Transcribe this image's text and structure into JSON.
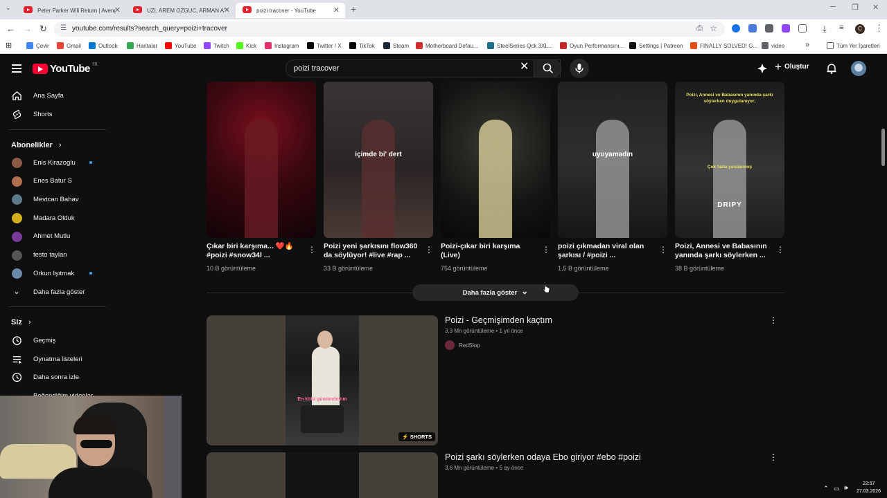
{
  "browser": {
    "tabs": [
      {
        "title": "Peter Parker Will Return | Aveng",
        "active": false
      },
      {
        "title": "UZI, AREM OZGUC, ARMAN AY",
        "active": false
      },
      {
        "title": "poizi tracover - YouTube",
        "active": true
      }
    ],
    "url": "youtube.com/results?search_query=poizi+tracover",
    "bookmarks": [
      "Çevir",
      "Gmail",
      "Outlook",
      "Haritalar",
      "YouTube",
      "Twitch",
      "Kick",
      "Instagram",
      "Twitter / X",
      "TikTok",
      "Steam",
      "Motherboard Defau...",
      "SteelSeries Qck 3XL...",
      "Oyun Performansını...",
      "Settings | Patreon",
      "FINALLY SOLVED! G...",
      "video"
    ],
    "bookmarks_all": "Tüm Yer İşaretleri",
    "bookmark_colors": [
      "#4285f4",
      "#ea4335",
      "#0078d4",
      "#34a853",
      "#ff0000",
      "#9146ff",
      "#53fc18",
      "#e1306c",
      "#000000",
      "#010101",
      "#1b2838",
      "#d32f2f",
      "#1f6f8b",
      "#c62828",
      "#111111",
      "#e64a19",
      "#5f6368"
    ],
    "profile_initial": "C"
  },
  "youtube": {
    "logo": "YouTube",
    "logo_region": "TR",
    "search_query": "poizi tracover",
    "create_label": "Oluştur",
    "accent": "#ff0033",
    "sidebar": {
      "home": "Ana Sayfa",
      "shorts": "Shorts",
      "subscriptions_title": "Abonelikler",
      "channels": [
        {
          "name": "Enis Kirazoglu",
          "new": true,
          "color": "#8a5a44"
        },
        {
          "name": "Enes Batur S",
          "new": false,
          "color": "#b07050"
        },
        {
          "name": "Mevtcan Bahav",
          "new": false,
          "color": "#5a7a8a"
        },
        {
          "name": "Madara Olduk",
          "new": false,
          "color": "#d4b020"
        },
        {
          "name": "Ahmet Mutlu",
          "new": false,
          "color": "#7a3a9a"
        },
        {
          "name": "testo taylan",
          "new": false,
          "color": "#555555"
        },
        {
          "name": "Orkun Işıtmak",
          "new": true,
          "color": "#6a8aaa"
        }
      ],
      "show_more": "Daha fazla göster",
      "you_title": "Siz",
      "history": "Geçmiş",
      "playlists": "Oynatma listeleri",
      "watch_later": "Daha sonra izle",
      "liked": "Beğendiğim videolar"
    },
    "shorts": [
      {
        "title": "Çıkar biri karşıma... ❤️🔥 #poizi #snow34l ...",
        "views": "10 B görüntüleme",
        "caption": ""
      },
      {
        "title": "Poizi yeni şarkısını flow360 da söylüyor! #live #rap ...",
        "views": "33 B görüntüleme",
        "caption": "içimde bi' dert"
      },
      {
        "title": "Poizi-çıkar biri karşıma (Live)",
        "views": "754 görüntüleme",
        "caption": ""
      },
      {
        "title": "poizi çıkmadan viral olan şarkısı / #poizi ...",
        "views": "1,5 B görüntüleme",
        "caption": "uyuyamadın"
      },
      {
        "title": "Poizi, Annesi ve Babasının yanında şarkı söylerken ...",
        "views": "38 B görüntüleme",
        "caption": "DRIPY"
      }
    ],
    "short5_top_caption": "Poizi, Annesi ve Babasının yanında şarkı söylerken duygulanıyor;",
    "short5_mid_caption": "Çok fazla yaralanmış",
    "show_more_label": "Daha fazla göster",
    "videos": [
      {
        "title": "Poizi - Geçmişimden kaçtım",
        "views": "3,3 Mn görüntüleme",
        "age": "1 yıl önce",
        "channel": "RedSlop",
        "badge": "SHORTS",
        "overlay": "En kötü günümdeyim"
      },
      {
        "title": "Poizi şarkı söylerken odaya Ebo giriyor #ebo #poizi",
        "views": "3,6 Mn görüntüleme",
        "age": "5 ay önce",
        "channel": "",
        "badge": "",
        "overlay": ""
      }
    ],
    "separator": "•"
  },
  "taskbar": {
    "time": "22:57",
    "date": "27.03.2026"
  }
}
